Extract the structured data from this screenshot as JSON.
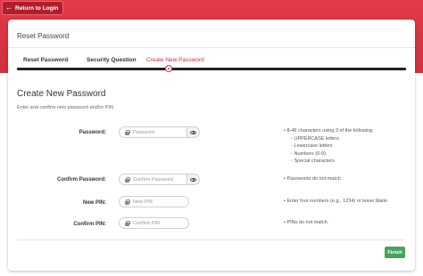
{
  "header": {
    "back_label": "Return to Login"
  },
  "card": {
    "title": "Reset Password"
  },
  "steps": [
    {
      "label": "Reset Password",
      "state": "done"
    },
    {
      "label": "Security Question",
      "state": "done"
    },
    {
      "label": "Create New Password",
      "state": "active"
    }
  ],
  "form": {
    "title": "Create New Password",
    "subtitle": "Enter and confirm new password and/or PIN",
    "password": {
      "label": "Password:",
      "placeholder": "Password"
    },
    "confirm_password": {
      "label": "Confirm Password:",
      "placeholder": "Confirm Password"
    },
    "new_pin": {
      "label": "New PIN:",
      "placeholder": "New PIN"
    },
    "confirm_pin": {
      "label": "Confirm PIN:",
      "placeholder": "Confirm PIN"
    }
  },
  "hints": {
    "password_intro": "8-46 characters using 3 of the following:",
    "password_rules": [
      "UPPERCASE letters",
      "Lowercase letters",
      "Numbers (0-9)",
      "Special characters"
    ],
    "password_match": "Passwords do not match",
    "pin_format": "Enter four numbers (e.g., 1234) or leave blank",
    "pin_match": "PINs do not match."
  },
  "actions": {
    "finish_label": "Finish"
  },
  "colors": {
    "brand_red": "#d2303e",
    "finish_green": "#46a35e"
  },
  "icons": {
    "back": "arrow-left-icon",
    "lock": "lock-icon",
    "eye": "eye-icon"
  }
}
